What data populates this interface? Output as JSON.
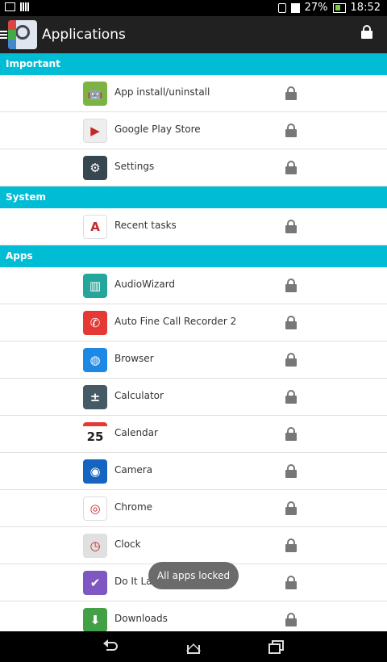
{
  "status_bar": {
    "battery": "27%",
    "time": "18:52"
  },
  "header": {
    "title": "Applications",
    "lock_icon": "lock-icon"
  },
  "sections": [
    {
      "title": "Important",
      "apps": [
        {
          "label": "App install/uninstall",
          "icon": "android-icon",
          "color": "#7cb342"
        },
        {
          "label": "Google Play Store",
          "icon": "play-store-icon",
          "color": "#eeeeee"
        },
        {
          "label": "Settings",
          "icon": "gear-icon",
          "color": "#37474f"
        }
      ]
    },
    {
      "title": "System",
      "apps": [
        {
          "label": "Recent tasks",
          "icon": "android-recent-icon",
          "color": "#ffffff"
        }
      ]
    },
    {
      "title": "Apps",
      "apps": [
        {
          "label": "AudioWizard",
          "icon": "audio-wizard-icon",
          "color": "#26a69a"
        },
        {
          "label": "Auto Fine Call Recorder 2",
          "icon": "call-recorder-icon",
          "color": "#e53935"
        },
        {
          "label": "Browser",
          "icon": "globe-icon",
          "color": "#1e88e5"
        },
        {
          "label": "Calculator",
          "icon": "calculator-icon",
          "color": "#455a64"
        },
        {
          "label": "Calendar",
          "icon": "calendar-icon",
          "color": "#ffffff",
          "badge": "25"
        },
        {
          "label": "Camera",
          "icon": "camera-icon",
          "color": "#1565c0"
        },
        {
          "label": "Chrome",
          "icon": "chrome-icon",
          "color": "#ffffff"
        },
        {
          "label": "Clock",
          "icon": "clock-icon",
          "color": "#e0e0e0"
        },
        {
          "label": "Do It Later",
          "icon": "checkmark-icon",
          "color": "#7e57c2"
        },
        {
          "label": "Downloads",
          "icon": "download-icon",
          "color": "#43a047"
        }
      ]
    }
  ],
  "toast": "All apps locked",
  "nav": {
    "back": "back-icon",
    "home": "home-icon",
    "recent": "recent-apps-icon"
  },
  "colors": {
    "section_header": "#00bcd4",
    "app_bar": "#212121",
    "lock": "#777777"
  }
}
